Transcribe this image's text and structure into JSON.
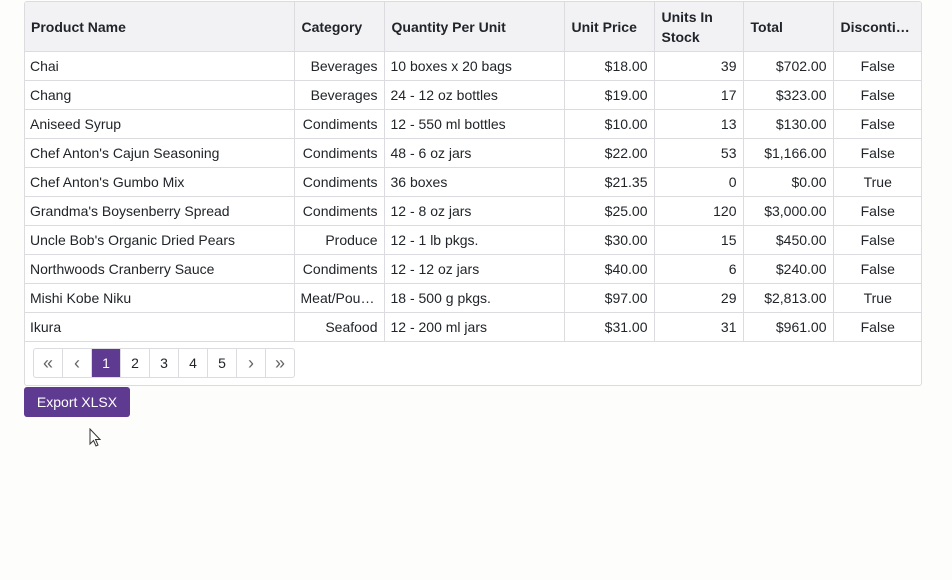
{
  "columns": [
    "Product Name",
    "Category",
    "Quantity Per Unit",
    "Unit Price",
    "Units In Stock",
    "Total",
    "Discontinued"
  ],
  "rows": [
    [
      "Chai",
      "Beverages",
      "10 boxes x 20 bags",
      "$18.00",
      "39",
      "$702.00",
      "False"
    ],
    [
      "Chang",
      "Beverages",
      "24 - 12 oz bottles",
      "$19.00",
      "17",
      "$323.00",
      "False"
    ],
    [
      "Aniseed Syrup",
      "Condiments",
      "12 - 550 ml bottles",
      "$10.00",
      "13",
      "$130.00",
      "False"
    ],
    [
      "Chef Anton's Cajun Seasoning",
      "Condiments",
      "48 - 6 oz jars",
      "$22.00",
      "53",
      "$1,166.00",
      "False"
    ],
    [
      "Chef Anton's Gumbo Mix",
      "Condiments",
      "36 boxes",
      "$21.35",
      "0",
      "$0.00",
      "True"
    ],
    [
      "Grandma's Boysenberry Spread",
      "Condiments",
      "12 - 8 oz jars",
      "$25.00",
      "120",
      "$3,000.00",
      "False"
    ],
    [
      "Uncle Bob's Organic Dried Pears",
      "Produce",
      "12 - 1 lb pkgs.",
      "$30.00",
      "15",
      "$450.00",
      "False"
    ],
    [
      "Northwoods Cranberry Sauce",
      "Condiments",
      "12 - 12 oz jars",
      "$40.00",
      "6",
      "$240.00",
      "False"
    ],
    [
      "Mishi Kobe Niku",
      "Meat/Poultry",
      "18 - 500 g pkgs.",
      "$97.00",
      "29",
      "$2,813.00",
      "True"
    ],
    [
      "Ikura",
      "Seafood",
      "12 - 200 ml jars",
      "$31.00",
      "31",
      "$961.00",
      "False"
    ]
  ],
  "pager": {
    "first": "«",
    "prev": "‹",
    "pages": [
      "1",
      "2",
      "3",
      "4",
      "5"
    ],
    "current": "1",
    "next": "›",
    "last": "»"
  },
  "export_label": "Export XLSX",
  "colors": {
    "accent": "#5f3a91"
  }
}
